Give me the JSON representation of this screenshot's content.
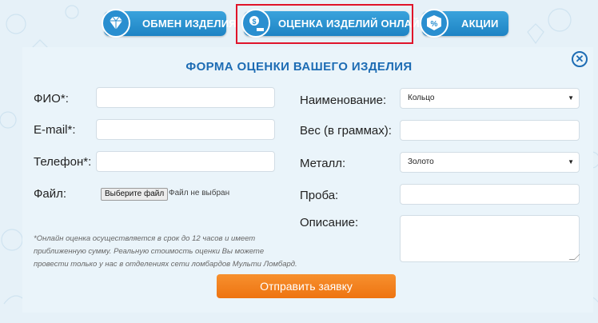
{
  "tabs": [
    {
      "label": "ОБМЕН ИЗДЕЛИЯ",
      "icon": "diamond-icon"
    },
    {
      "label": "ОЦЕНКА ИЗДЕЛИЙ ОНЛАЙН",
      "icon": "appraisal-icon"
    },
    {
      "label": "АКЦИИ",
      "icon": "percent-icon"
    }
  ],
  "form": {
    "title": "ФОРМА ОЦЕНКИ ВАШЕГО ИЗДЕЛИЯ",
    "close_symbol": "✕",
    "fio_label": "ФИО*:",
    "email_label": "E-mail*:",
    "phone_label": "Телефон*:",
    "file_label": "Файл:",
    "file_button": "Выберите файл",
    "file_status": "Файл не выбран",
    "name_label": "Наименование:",
    "name_value": "Кольцо",
    "weight_label": "Вес (в граммах):",
    "metal_label": "Металл:",
    "metal_value": "Золото",
    "probe_label": "Проба:",
    "description_label": "Описание:",
    "note_lines": [
      "*Онлайн оценка осуществляется в срок до 12 часов и имеет",
      "приближенную сумму. Реальную стоимость оценки Вы можете",
      "провести только у нас в отделениях сети ломбардов Мульти Ломбард."
    ],
    "submit_label": "Отправить заявку"
  },
  "colors": {
    "tab_blue": "#2a93d2",
    "highlight_red": "#e0142a",
    "title_blue": "#1d6cb4",
    "submit_orange": "#f28220"
  }
}
